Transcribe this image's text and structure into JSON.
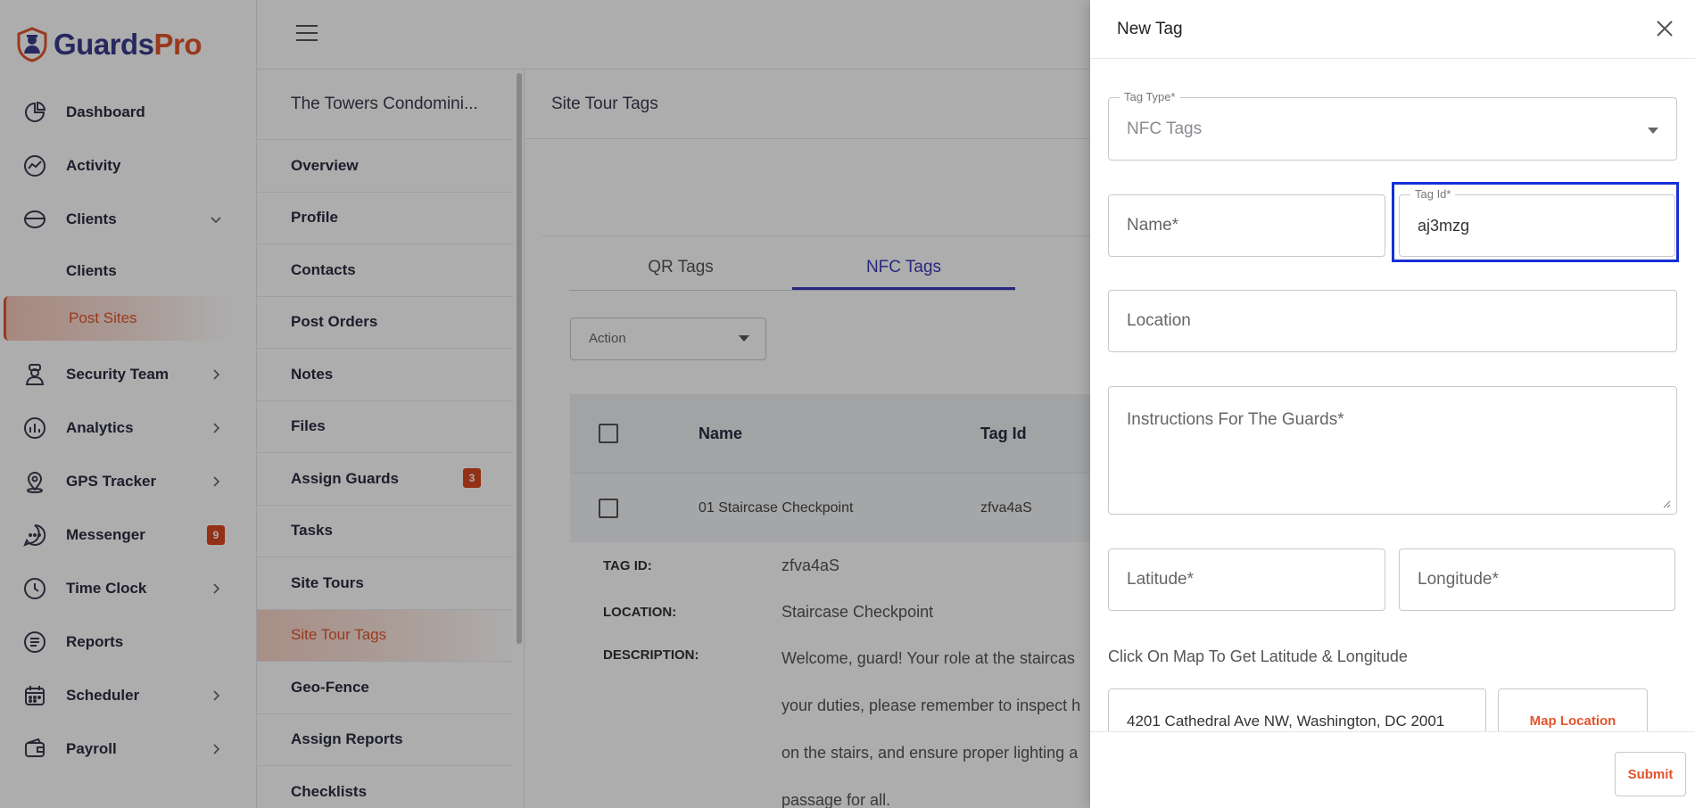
{
  "brand": {
    "part1": "Guards",
    "part2": "Pro"
  },
  "sidebar": {
    "items": [
      {
        "label": "Dashboard"
      },
      {
        "label": "Activity"
      },
      {
        "label": "Clients"
      },
      {
        "label": "Clients"
      },
      {
        "label": "Post Sites"
      },
      {
        "label": "Security Team"
      },
      {
        "label": "Analytics"
      },
      {
        "label": "GPS Tracker"
      },
      {
        "label": "Messenger",
        "badge": "9"
      },
      {
        "label": "Time Clock"
      },
      {
        "label": "Reports"
      },
      {
        "label": "Scheduler"
      },
      {
        "label": "Payroll"
      }
    ]
  },
  "submenu": {
    "title": "The Towers Condomini...",
    "items": [
      {
        "label": "Overview"
      },
      {
        "label": "Profile"
      },
      {
        "label": "Contacts"
      },
      {
        "label": "Post Orders"
      },
      {
        "label": "Notes"
      },
      {
        "label": "Files"
      },
      {
        "label": "Assign Guards",
        "badge": "3"
      },
      {
        "label": "Tasks"
      },
      {
        "label": "Site Tours"
      },
      {
        "label": "Site Tour Tags"
      },
      {
        "label": "Geo-Fence"
      },
      {
        "label": "Assign Reports"
      },
      {
        "label": "Checklists"
      }
    ]
  },
  "main": {
    "header": "Site Tour Tags",
    "tabs": [
      {
        "label": "QR Tags"
      },
      {
        "label": "NFC Tags"
      }
    ],
    "action_label": "Action",
    "table": {
      "headers": {
        "name": "Name",
        "tag_id": "Tag Id"
      },
      "rows": [
        {
          "name": "01 Staircase Checkpoint",
          "tag_id": "zfva4aS"
        }
      ]
    },
    "details": {
      "tag_id_label": "TAG ID:",
      "tag_id_value": "zfva4aS",
      "location_label": "LOCATION:",
      "location_value": "Staircase Checkpoint",
      "description_label": "DESCRIPTION:",
      "description_lines": [
        "Welcome, guard! Your role at the staircas",
        "your duties, please remember to inspect h",
        "on the stairs, and ensure proper lighting a",
        "passage for all."
      ]
    }
  },
  "drawer": {
    "title": "New Tag",
    "tag_type_label": "Tag Type*",
    "tag_type_value": "NFC Tags",
    "name_placeholder": "Name*",
    "tag_id_label": "Tag Id*",
    "tag_id_value": "aj3mzg",
    "location_placeholder": "Location",
    "instructions_placeholder": "Instructions For The Guards*",
    "latitude_placeholder": "Latitude*",
    "longitude_placeholder": "Longitude*",
    "map_hint": "Click On Map To Get Latitude & Longitude",
    "address_value": "4201 Cathedral Ave NW, Washington, DC 2001",
    "map_location_label": "Map Location",
    "submit_label": "Submit"
  }
}
